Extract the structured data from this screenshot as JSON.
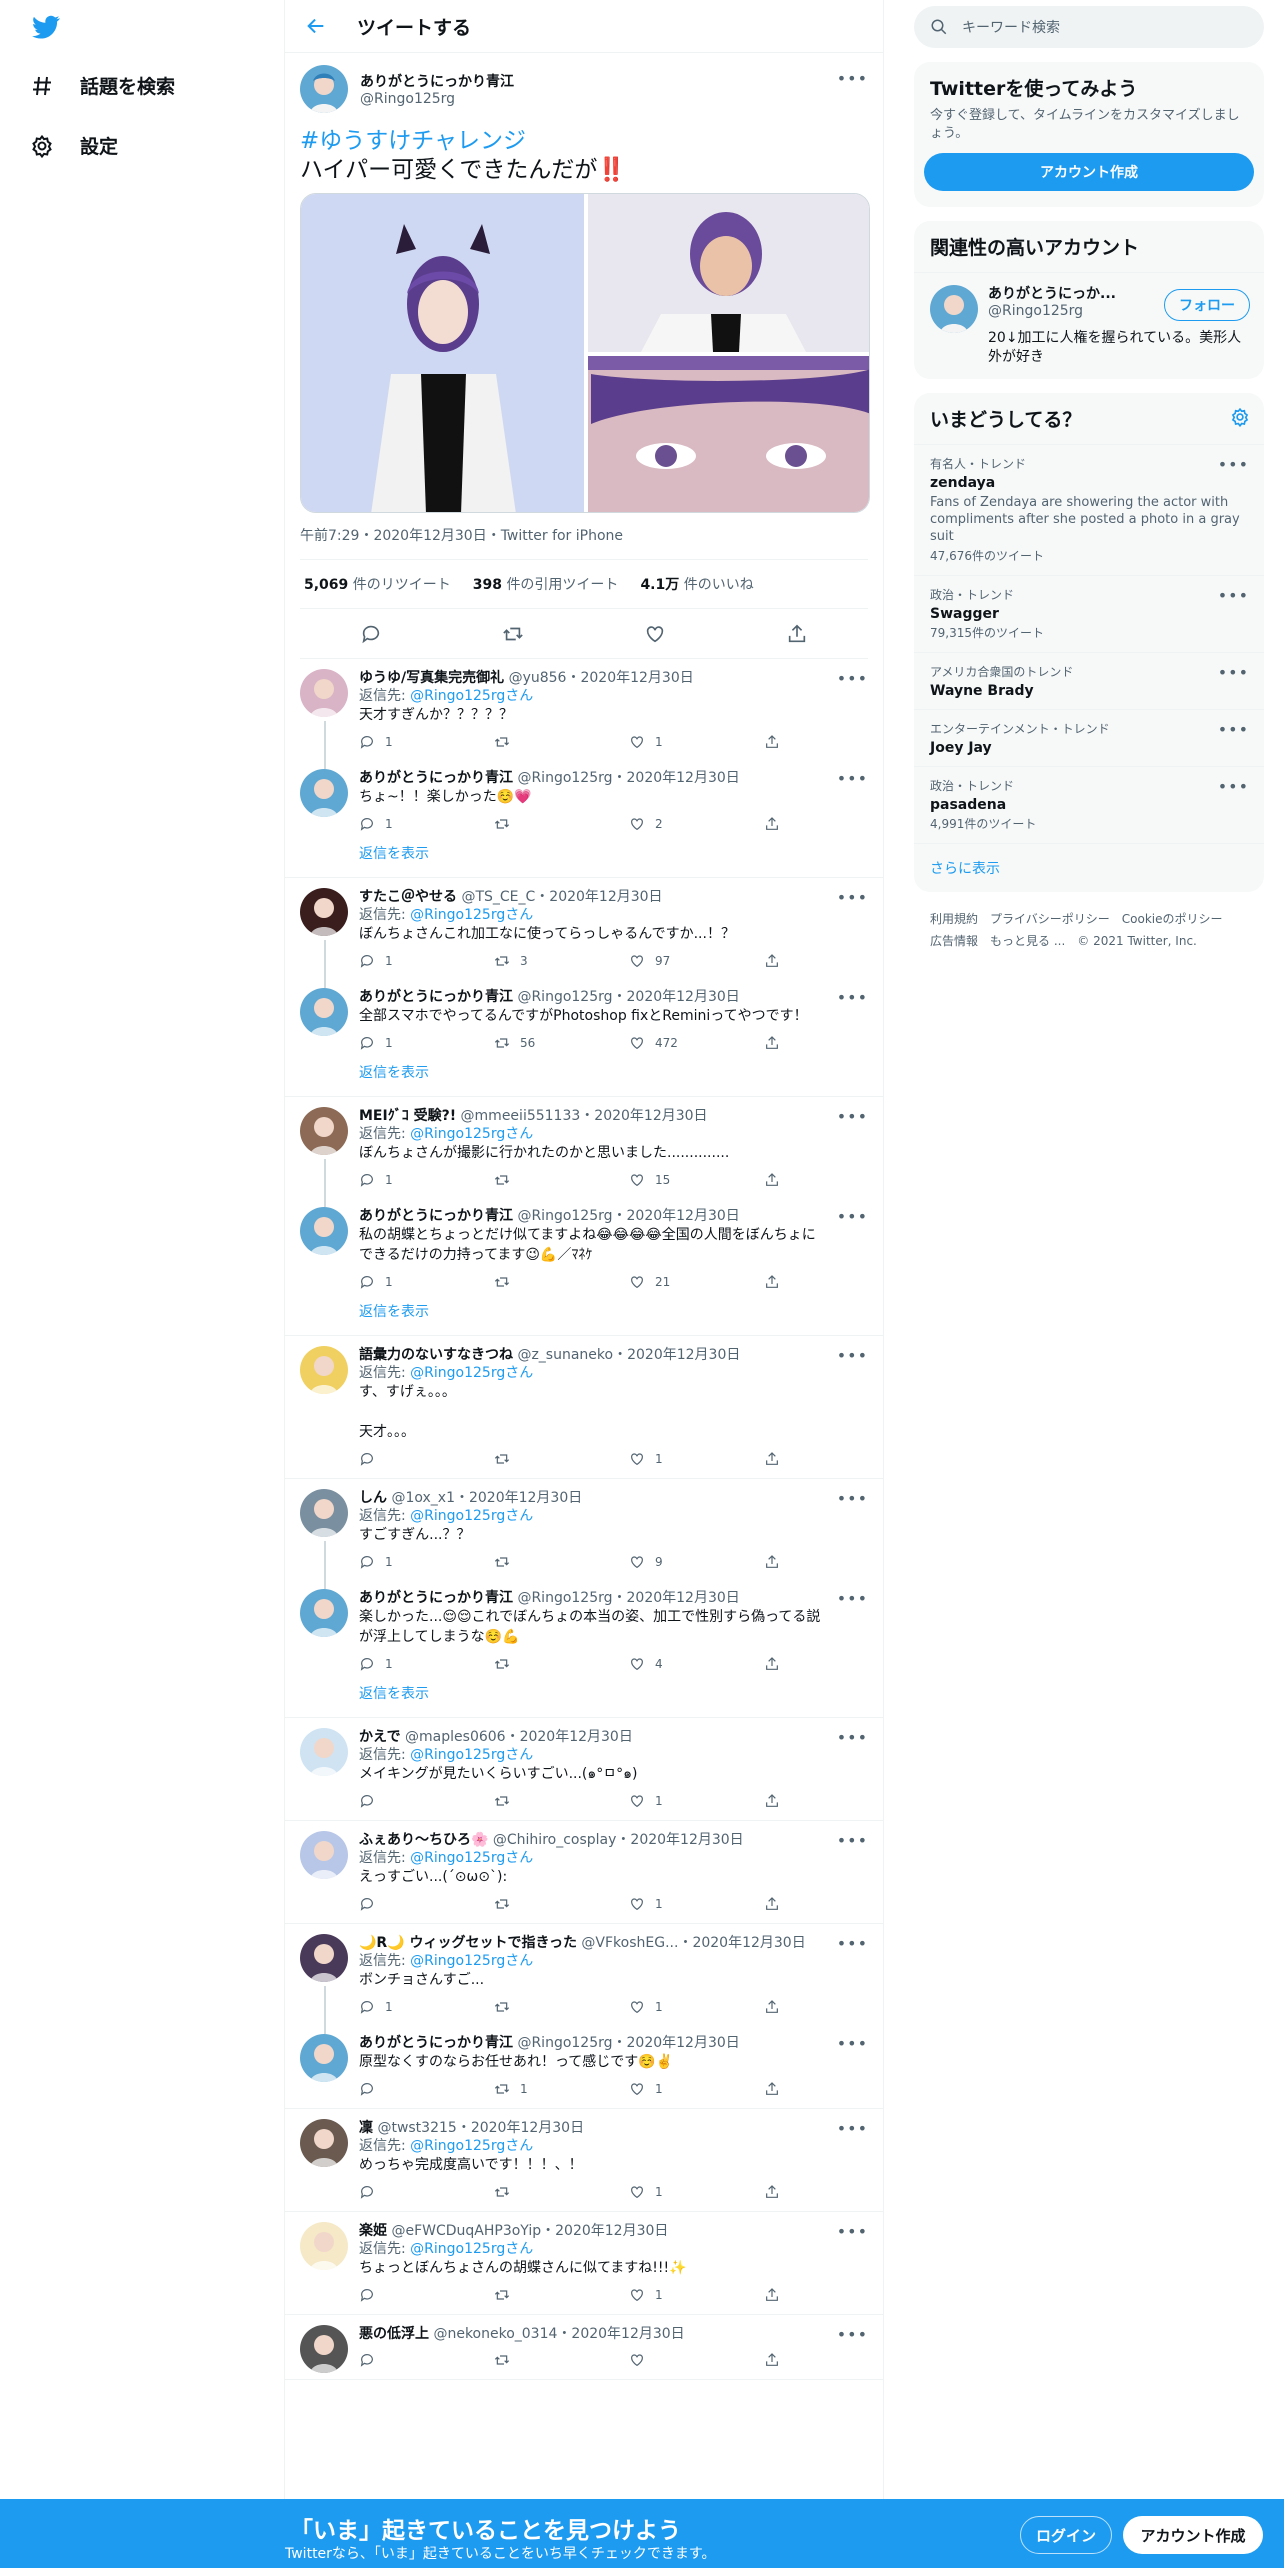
{
  "nav": {
    "explore_label": "話題を検索",
    "settings_label": "設定"
  },
  "header": {
    "title": "ツイートする"
  },
  "tweet": {
    "author_name": "ありがとうにっかり青江",
    "author_handle": "@Ringo125rg",
    "hashtag": "#ゆうすけチャレンジ",
    "text": "ハイパー可愛くできたんだが",
    "emoji": "‼️",
    "timestamp": "午前7:29・2020年12月30日・Twitter for iPhone",
    "retweets_num": "5,069",
    "retweets_label": "件のリツイート",
    "quotes_num": "398",
    "quotes_label": "件の引用ツイート",
    "likes_num": "4.1万",
    "likes_label": "件のいいね"
  },
  "replies": [
    {
      "name": "ゆうゆ/写真集完売御礼",
      "handle": "@yu856",
      "date": "2020年12月30日",
      "replyto": "@Ringo125rgさん",
      "text": "天才すぎんか？？？？？",
      "counts": [
        "1",
        "",
        "1"
      ],
      "avatar_color": "#d9b3c6"
    },
    {
      "name": "ありがとうにっかり青江",
      "handle": "@Ringo125rg",
      "date": "2020年12月30日",
      "replyto": "",
      "text": "ちょ~！！楽しかった☺️💗",
      "counts": [
        "1",
        "",
        "2"
      ],
      "avatar_color": "#5fa8d3",
      "show_more": "返信を表示"
    },
    {
      "name": "すたこ＠やせる",
      "handle": "@TS_CE_C",
      "date": "2020年12月30日",
      "replyto": "@Ringo125rgさん",
      "text": "ぼんちょさんこれ加工なに使ってらっしゃるんですか...！？",
      "counts": [
        "1",
        "3",
        "97"
      ],
      "avatar_color": "#3a1e1e"
    },
    {
      "name": "ありがとうにっかり青江",
      "handle": "@Ringo125rg",
      "date": "2020年12月30日",
      "replyto": "",
      "text": "全部スマホでやってるんですがPhotoshop fixとReminiってやつです！",
      "counts": [
        "1",
        "56",
        "472"
      ],
      "avatar_color": "#5fa8d3",
      "show_more": "返信を表示"
    },
    {
      "name": "MEIｸﾞｺ 受験?!",
      "handle": "@mmeeii551133",
      "date": "2020年12月30日",
      "replyto": "@Ringo125rgさん",
      "text": "ぼんちょさんが撮影に行かれたのかと思いました..............",
      "counts": [
        "1",
        "",
        "15"
      ],
      "avatar_color": "#8c6a55"
    },
    {
      "name": "ありがとうにっかり青江",
      "handle": "@Ringo125rg",
      "date": "2020年12月30日",
      "replyto": "",
      "text": "私の胡蝶とちょっとだけ似てますよね😂😂😂😂全国の人間をぼんちょに\nできるだけの力持ってます😉💪／ﾏﾈｹ",
      "counts": [
        "1",
        "",
        "21"
      ],
      "avatar_color": "#5fa8d3",
      "show_more": "返信を表示"
    },
    {
      "name": "語彙力のないすなきつね",
      "handle": "@z_sunaneko",
      "date": "2020年12月30日",
      "replyto": "@Ringo125rgさん",
      "text": "す、すげぇ。。。\n\n天才。。。",
      "counts": [
        "",
        "",
        "1"
      ],
      "avatar_color": "#f0d060"
    },
    {
      "name": "しん",
      "handle": "@1ox_x1",
      "date": "2020年12月30日",
      "replyto": "@Ringo125rgさん",
      "text": "すごすぎん...？？",
      "counts": [
        "1",
        "",
        "9"
      ],
      "avatar_color": "#7a8fa0"
    },
    {
      "name": "ありがとうにっかり青江",
      "handle": "@Ringo125rg",
      "date": "2020年12月30日",
      "replyto": "",
      "text": "楽しかった...😌😌これでぼんちょの本当の姿、加工で性別すら偽ってる説\nが浮上してしまうな☺️💪",
      "counts": [
        "1",
        "",
        "4"
      ],
      "avatar_color": "#5fa8d3",
      "show_more": "返信を表示"
    },
    {
      "name": "かえで",
      "handle": "@maples0606",
      "date": "2020年12月30日",
      "replyto": "@Ringo125rgさん",
      "text": "メイキングが見たいくらいすごい...(๑°ㅁ°๑)",
      "counts": [
        "",
        "",
        "1"
      ],
      "avatar_color": "#cfe3f2"
    },
    {
      "name": "ふぇあり～ちひろ🌸",
      "handle": "@Chihiro_cosplay",
      "date": "2020年12月30日",
      "replyto": "@Ringo125rgさん",
      "text": "えっすごい...(´⊙ω⊙`):",
      "counts": [
        "",
        "",
        "1"
      ],
      "avatar_color": "#b8c7e8"
    },
    {
      "name": "🌙R🌙 ウィッグセットで指きった",
      "handle": "@VFkoshEG...",
      "date": "2020年12月30日",
      "replyto": "@Ringo125rgさん",
      "text": "ボンチョさんすご...",
      "counts": [
        "1",
        "",
        "1"
      ],
      "avatar_color": "#4a3a5a"
    },
    {
      "name": "ありがとうにっかり青江",
      "handle": "@Ringo125rg",
      "date": "2020年12月30日",
      "replyto": "",
      "text": "原型なくすのならお任せあれ！って感じです☺️✌️",
      "counts": [
        "",
        "1",
        "1"
      ],
      "avatar_color": "#5fa8d3"
    },
    {
      "name": "凜",
      "handle": "@twst3215",
      "date": "2020年12月30日",
      "replyto": "@Ringo125rgさん",
      "text": "めっちゃ完成度高いです！！！、！",
      "counts": [
        "",
        "",
        "1"
      ],
      "avatar_color": "#6a5a50"
    },
    {
      "name": "楽姫",
      "handle": "@eFWCDuqAHP3oYip",
      "date": "2020年12月30日",
      "replyto": "@Ringo125rgさん",
      "text": "ちょっとぼんちょさんの胡蝶さんに似てますね!!!✨",
      "counts": [
        "",
        "",
        "1"
      ],
      "avatar_color": "#f5e9c8"
    },
    {
      "name": "悪の低浮上",
      "handle": "@nekoneko_0314",
      "date": "2020年12月30日",
      "replyto": "",
      "text": "",
      "counts": [
        "",
        "",
        ""
      ],
      "avatar_color": "#555555"
    }
  ],
  "sidebar": {
    "search_placeholder": "キーワード検索",
    "signup": {
      "title": "Twitterを使ってみよう",
      "desc": "今すぐ登録して、タイムラインをカスタマイズしましょう。",
      "button": "アカウント作成"
    },
    "related": {
      "title": "関連性の高いアカウント",
      "name": "ありがとうにっか...",
      "handle": "@Ringo125rg",
      "follow": "フォロー",
      "bio": "20↓加工に人権を握られている。美形人外が好き"
    },
    "trends": {
      "title": "いまどうしてる？",
      "items": [
        {
          "category": "有名人・トレンド",
          "name": "zendaya",
          "desc": "Fans of Zendaya are showering the actor with compliments after she posted a photo in a gray suit",
          "count": "47,676件のツイート"
        },
        {
          "category": "政治・トレンド",
          "name": "Swagger",
          "desc": "",
          "count": "79,315件のツイート"
        },
        {
          "category": "アメリカ合衆国のトレンド",
          "name": "Wayne Brady",
          "desc": "",
          "count": ""
        },
        {
          "category": "エンターテインメント・トレンド",
          "name": "Joey Jay",
          "desc": "",
          "count": ""
        },
        {
          "category": "政治・トレンド",
          "name": "pasadena",
          "desc": "",
          "count": "4,991件のツイート"
        }
      ],
      "show_more": "さらに表示"
    },
    "footer": [
      "利用規約",
      "プライバシーポリシー",
      "Cookieのポリシー",
      "広告情報",
      "もっと見る ...",
      "© 2021 Twitter, Inc."
    ]
  },
  "bottom": {
    "title": "「いま」起きていることを見つけよう",
    "subtitle": "Twitterなら、「いま」起きていることをいち早くチェックできます。",
    "login": "ログイン",
    "signup": "アカウント作成"
  }
}
